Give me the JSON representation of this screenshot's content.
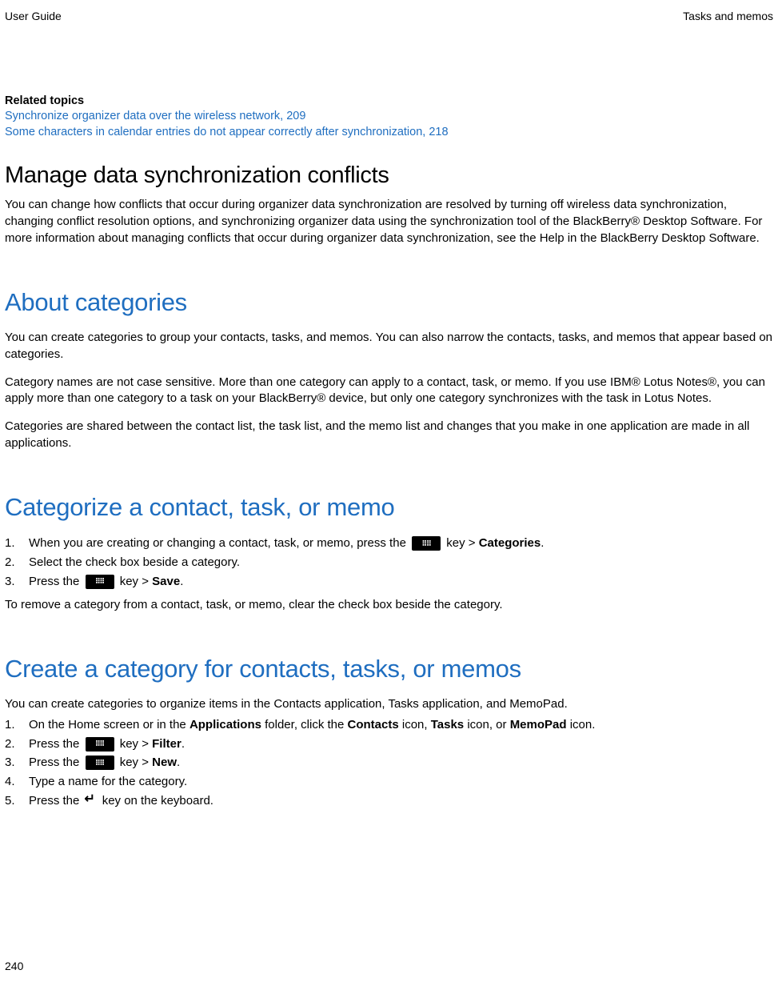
{
  "header": {
    "left": "User Guide",
    "right": "Tasks and memos"
  },
  "related": {
    "label": "Related topics",
    "links": [
      "Synchronize organizer data over the wireless network, 209",
      "Some characters in calendar entries do not appear correctly after synchronization, 218"
    ]
  },
  "sections": {
    "manage": {
      "heading": "Manage data synchronization conflicts",
      "body": "You can change how conflicts that occur during organizer data synchronization are resolved by turning off wireless data synchronization, changing conflict resolution options, and synchronizing organizer data using the synchronization tool of the BlackBerry® Desktop Software. For more information about managing conflicts that occur during organizer data synchronization, see the Help in the BlackBerry Desktop Software."
    },
    "about": {
      "heading": "About categories",
      "p1": "You can create categories to group your contacts, tasks, and memos. You can also narrow the contacts, tasks, and memos that appear based on categories.",
      "p2": "Category names are not case sensitive. More than one category can apply to a contact, task, or memo. If you use IBM® Lotus Notes®, you can apply more than one category to a task on your BlackBerry® device, but only one category synchronizes with the task in Lotus Notes.",
      "p3": "Categories are shared between the contact list, the task list, and the memo list and changes that you make in one application are made in all applications."
    },
    "categorize": {
      "heading": "Categorize a contact, task, or memo",
      "step1_a": "When you are creating or changing a contact, task, or memo, press the ",
      "step1_b": " key > ",
      "step1_c": "Categories",
      "step1_d": ".",
      "step2": "Select the check box beside a category.",
      "step3_a": "Press the ",
      "step3_b": " key > ",
      "step3_c": "Save",
      "step3_d": ".",
      "after": "To remove a category from a contact, task, or memo, clear the check box beside the category."
    },
    "create": {
      "heading": "Create a category for contacts, tasks, or memos",
      "intro": "You can create categories to organize items in the Contacts application, Tasks application, and MemoPad.",
      "step1_a": "On the Home screen or in the ",
      "step1_b": "Applications",
      "step1_c": " folder, click the ",
      "step1_d": "Contacts",
      "step1_e": " icon, ",
      "step1_f": "Tasks",
      "step1_g": " icon, or ",
      "step1_h": "MemoPad",
      "step1_i": " icon.",
      "step2_a": "Press the ",
      "step2_b": " key > ",
      "step2_c": "Filter",
      "step2_d": ".",
      "step3_a": "Press the ",
      "step3_b": " key > ",
      "step3_c": "New",
      "step3_d": ".",
      "step4": "Type a name for the category.",
      "step5_a": "Press the ",
      "step5_b": " key on the keyboard."
    }
  },
  "footer": {
    "page": "240"
  }
}
